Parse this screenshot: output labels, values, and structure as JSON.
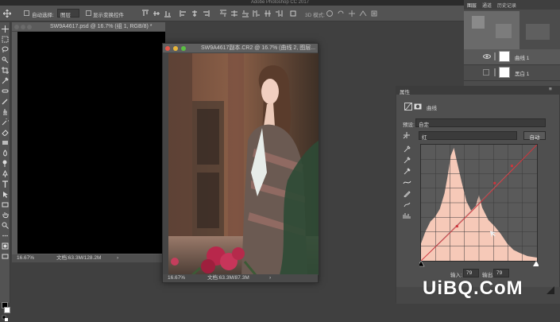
{
  "app": {
    "title": "Adobe Photoshop CC 2017"
  },
  "options_bar": {
    "auto_select_label": "自动选择:",
    "auto_select_value": "图层",
    "show_transform_label": "显示变换控件",
    "mode_3d_label": "3D 模式:"
  },
  "doc1": {
    "title": "SW9A4617.psd @ 16.7% (组 1, RGB/8) *",
    "zoom": "16.67%",
    "doc_size": "文档:63.3M/128.2M"
  },
  "doc2": {
    "title": "SW9A4617副本.CR2 @ 16.7% (曲线 2, 图层...",
    "zoom": "16.67%",
    "doc_size": "文档:63.3M/87.3M"
  },
  "layers_panel": {
    "tabs": [
      "图层",
      "通道",
      "历史记录"
    ],
    "layers": [
      {
        "name": "曲线 1"
      },
      {
        "name": "黑白 1"
      }
    ]
  },
  "properties_panel": {
    "title": "属性",
    "adjustment_name": "曲线",
    "preset_label": "预设:",
    "preset_value": "自定",
    "channel_value": "红",
    "auto_button": "自动",
    "input_label": "输入:",
    "input_value": "79",
    "output_label": "输出:",
    "output_value": "79"
  },
  "watermark": {
    "text": "UiBQ.CoM"
  },
  "colors": {
    "app_dark": "#2b2b2b",
    "panel": "#535353",
    "curve_red": "#d0343c",
    "histogram_fill": "#f6c9b8"
  }
}
